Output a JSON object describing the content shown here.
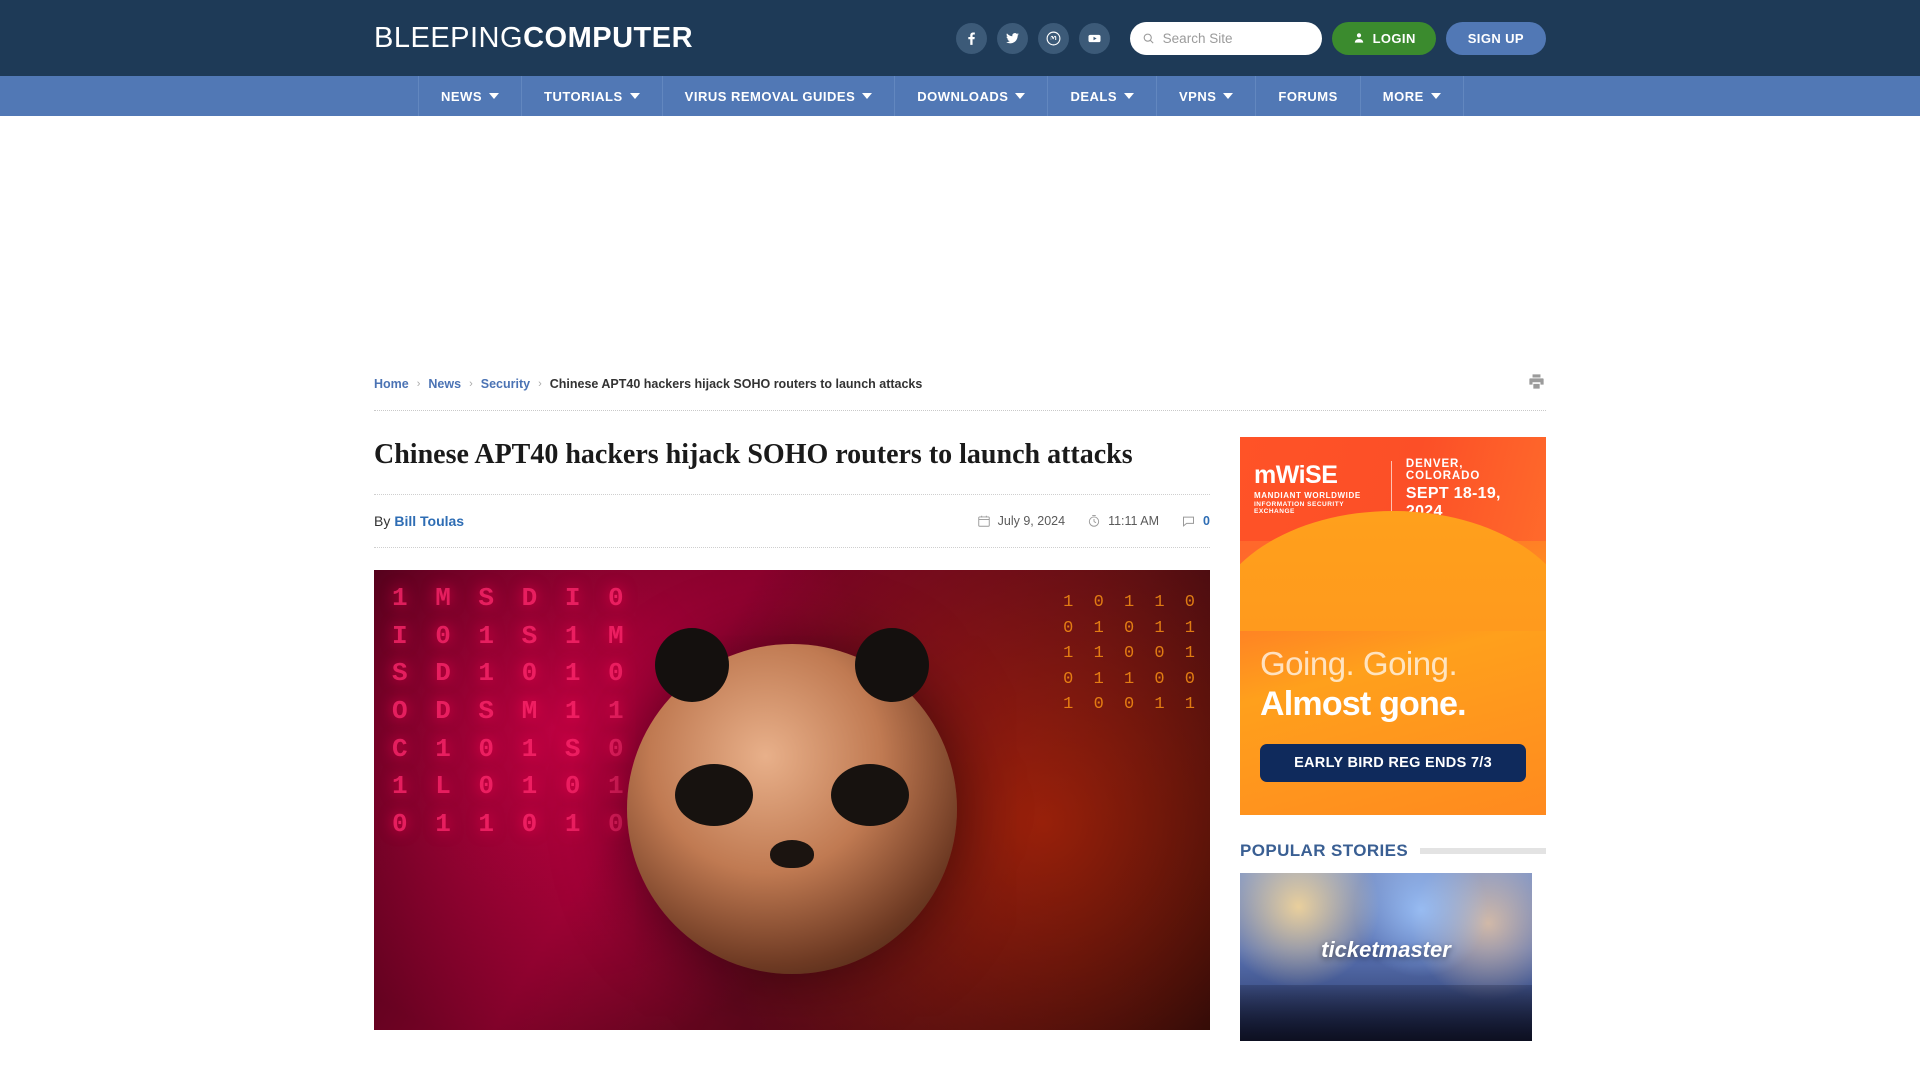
{
  "site": {
    "logo_light": "BLEEPING",
    "logo_bold": "COMPUTER",
    "colors": {
      "topbar_bg": "#1e3a57",
      "nav_bg": "#5178b5",
      "login_green": "#3b8b2e",
      "signup_blue": "#5178b5",
      "link_blue": "#4b73b4"
    }
  },
  "header": {
    "social": [
      {
        "name": "facebook-icon",
        "label": "Facebook"
      },
      {
        "name": "twitter-icon",
        "label": "Twitter"
      },
      {
        "name": "mastodon-icon",
        "label": "Mastodon"
      },
      {
        "name": "youtube-icon",
        "label": "YouTube"
      }
    ],
    "search": {
      "placeholder": "Search Site",
      "value": "",
      "icon": "search-icon"
    },
    "login_label": "LOGIN",
    "signup_label": "SIGN UP"
  },
  "nav": {
    "items": [
      {
        "label": "NEWS",
        "has_caret": true
      },
      {
        "label": "TUTORIALS",
        "has_caret": true
      },
      {
        "label": "VIRUS REMOVAL GUIDES",
        "has_caret": true
      },
      {
        "label": "DOWNLOADS",
        "has_caret": true
      },
      {
        "label": "DEALS",
        "has_caret": true
      },
      {
        "label": "VPNS",
        "has_caret": true
      },
      {
        "label": "FORUMS",
        "has_caret": false
      },
      {
        "label": "MORE",
        "has_caret": true
      }
    ]
  },
  "breadcrumb": {
    "home": "Home",
    "news": "News",
    "security": "Security",
    "current": "Chinese APT40 hackers hijack SOHO routers to launch attacks",
    "separator": "›",
    "print_icon": "printer-icon"
  },
  "article": {
    "title": "Chinese APT40 hackers hijack SOHO routers to launch attacks",
    "by_label": "By",
    "author": "Bill Toulas",
    "date": "July 9, 2024",
    "time": "11:11 AM",
    "comments": "0",
    "date_icon": "calendar-icon",
    "time_icon": "clock-icon",
    "comments_icon": "comment-icon",
    "hero_alt": "Hacker panda over red digital matrix code"
  },
  "sidebar": {
    "ad": {
      "logo_main": "mWiSE",
      "logo_sub1": "MANDIANT WORLDWIDE",
      "logo_sub2": "INFORMATION SECURITY EXCHANGE",
      "location": "DENVER, COLORADO",
      "dates": "SEPT 18-19, 2024",
      "headline_1": "Going. Going.",
      "headline_2": "Almost gone.",
      "cta": "EARLY BIRD REG ENDS 7/3"
    },
    "popular": {
      "title": "POPULAR STORIES",
      "thumb_label": "ticketmaster"
    }
  }
}
